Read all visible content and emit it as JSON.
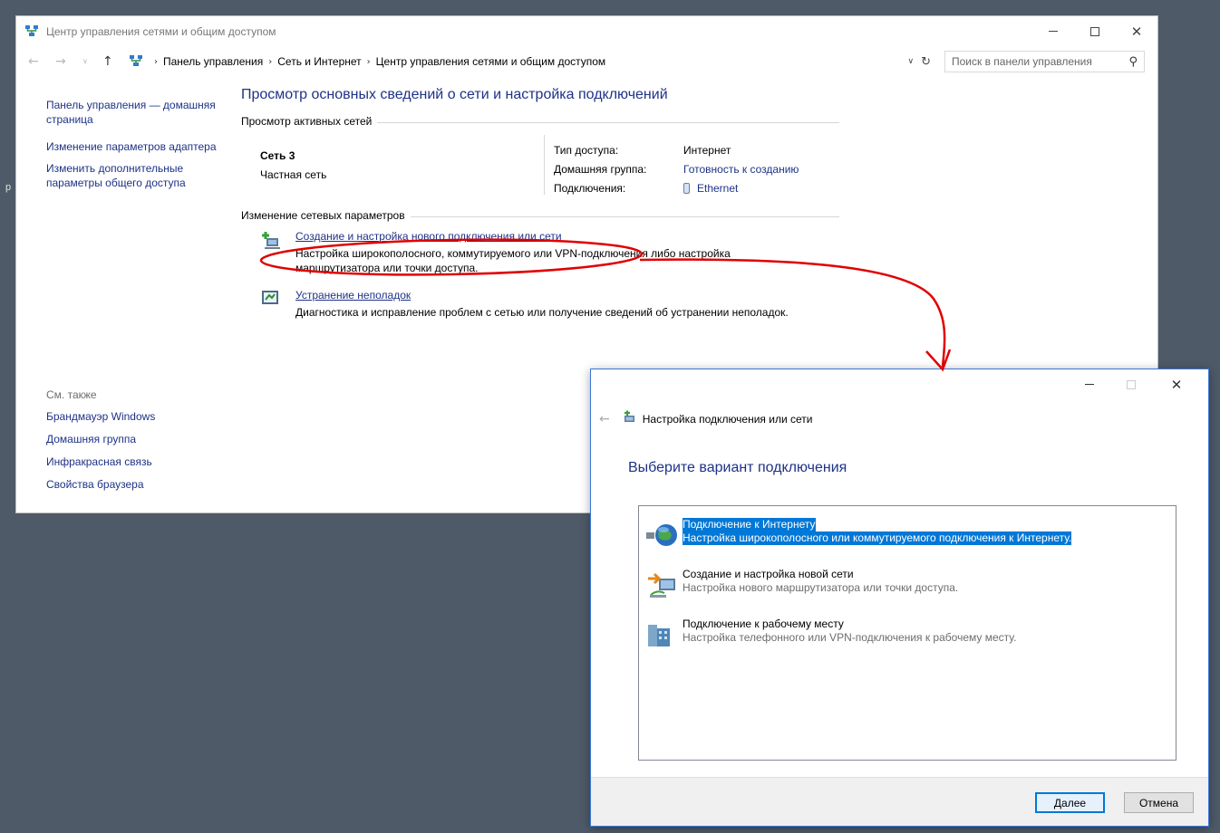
{
  "main_window": {
    "title": "Центр управления сетями и общим доступом",
    "breadcrumb": [
      "Панель управления",
      "Сеть и Интернет",
      "Центр управления сетями и общим доступом"
    ],
    "search_placeholder": "Поиск в панели управления"
  },
  "sidebar": {
    "home_label": "Панель управления — домашняя страница",
    "adapter_label": "Изменение параметров адаптера",
    "sharing_label": "Изменить дополнительные параметры общего доступа"
  },
  "see_also": {
    "header": "См. также",
    "items": [
      "Брандмауэр Windows",
      "Домашняя группа",
      "Инфракрасная связь",
      "Свойства браузера"
    ]
  },
  "content": {
    "title": "Просмотр основных сведений о сети и настройка подключений",
    "active_networks_header": "Просмотр активных сетей",
    "network_name": "Сеть  3",
    "network_type": "Частная сеть",
    "props": [
      {
        "key": "Тип доступа:",
        "value": "Интернет"
      },
      {
        "key": "Домашняя группа:",
        "value": "Готовность к созданию"
      },
      {
        "key": "Подключения:",
        "value": "Ethernet"
      }
    ],
    "change_header": "Изменение сетевых параметров",
    "tasks": [
      {
        "link": "Создание и настройка нового подключения или сети",
        "desc": "Настройка широкополосного, коммутируемого или VPN-подключения либо настройка маршрутизатора или точки доступа."
      },
      {
        "link": "Устранение неполадок",
        "desc": "Диагностика и исправление проблем с сетью или получение сведений об устранении неполадок."
      }
    ]
  },
  "wizard": {
    "title": "Настройка подключения или сети",
    "heading": "Выберите вариант подключения",
    "options": [
      {
        "title": "Подключение к Интернету",
        "desc": "Настройка широкополосного или коммутируемого подключения к Интернету.",
        "selected": true
      },
      {
        "title": "Создание и настройка новой сети",
        "desc": "Настройка нового маршрутизатора или точки доступа.",
        "selected": false
      },
      {
        "title": "Подключение к рабочему месту",
        "desc": "Настройка телефонного или VPN-подключения к рабочему месту.",
        "selected": false
      }
    ],
    "next_label": "Далее",
    "cancel_label": "Отмена"
  },
  "colors": {
    "link": "#1e3287",
    "selection": "#0078d7",
    "annotation": "#e00000",
    "desktop": "#4e5a68"
  }
}
